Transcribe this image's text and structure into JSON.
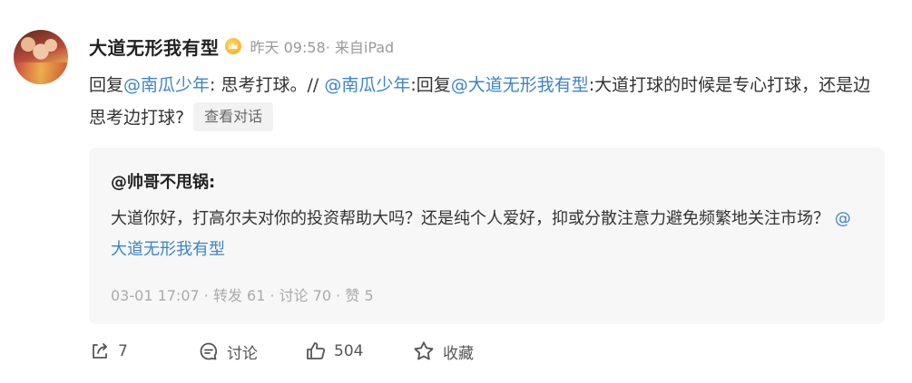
{
  "post": {
    "author": "大道无形我有型",
    "time": "昨天 09:58",
    "source": "· 来自iPad",
    "content": {
      "reply_prefix": "回复",
      "mention1": "@南瓜少年",
      "part1": ": 思考打球。// ",
      "mention2": "@南瓜少年",
      "part2": ":回复",
      "mention3": "@大道无形我有型",
      "part3": ":大道打球的时候是专心打球，还是边思考边打球?"
    },
    "view_conversation": "查看对话"
  },
  "quote": {
    "author": "@帅哥不甩锅",
    "author_suffix": ":",
    "text": "大道你好，打高尔夫对你的投资帮助大吗？还是纯个人爱好，抑或分散注意力避免频繁地关注市场？",
    "mention": "@大道无形我有型",
    "meta": "03-01 17:07  · 转发 61 · 讨论 70 · 赞 5"
  },
  "actions": {
    "forward_count": "7",
    "comment_label": "讨论",
    "like_count": "504",
    "favorite_label": "收藏"
  },
  "colors": {
    "mention": "#3e84c7",
    "quote_bg": "#f7f7f7",
    "meta": "#999999"
  }
}
